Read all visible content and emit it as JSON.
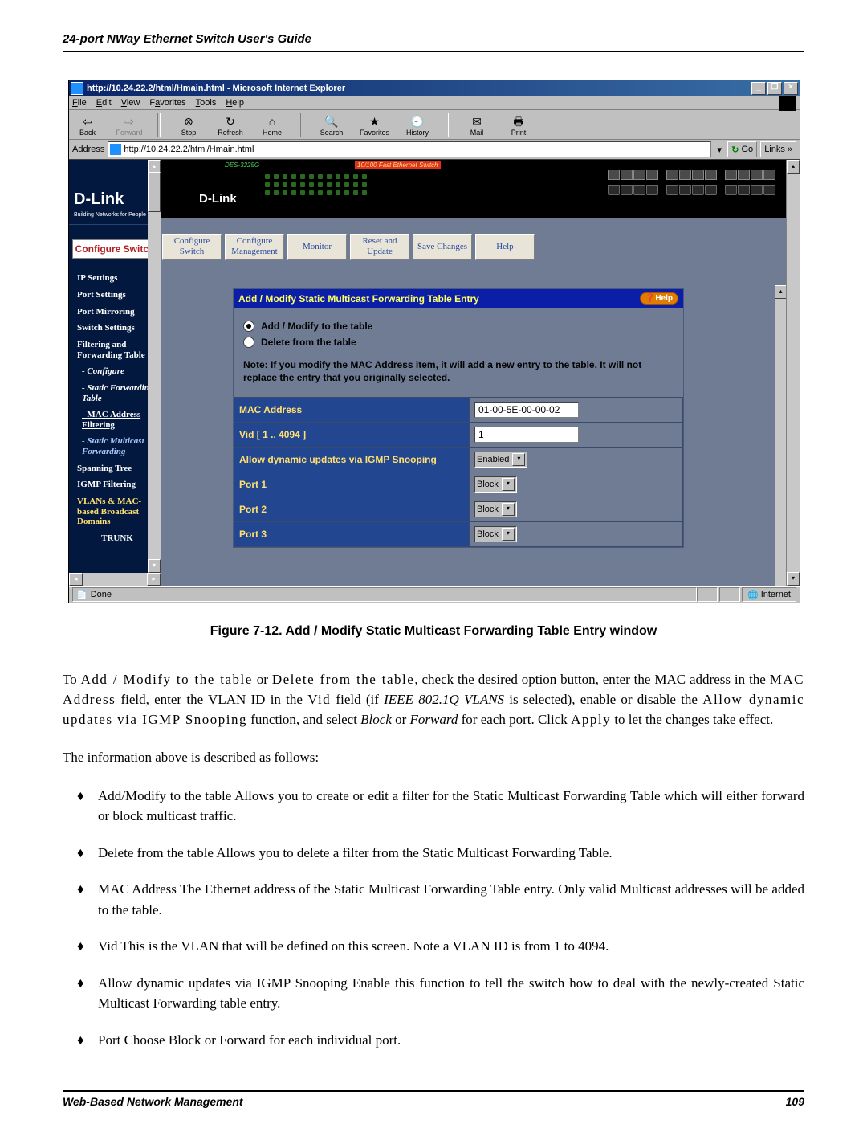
{
  "page": {
    "header": "24-port NWay Ethernet Switch User's Guide",
    "footer_left": "Web-Based Network Management",
    "footer_right": "109"
  },
  "caption": "Figure 7-12.  Add / Modify Static Multicast Forwarding Table Entry window",
  "browser": {
    "title": "http://10.24.22.2/html/Hmain.html - Microsoft Internet Explorer",
    "menu": {
      "file": "File",
      "edit": "Edit",
      "view": "View",
      "favorites": "Favorites",
      "tools": "Tools",
      "help": "Help"
    },
    "toolbar": {
      "back": "Back",
      "forward": "Forward",
      "stop": "Stop",
      "refresh": "Refresh",
      "home": "Home",
      "search": "Search",
      "favorites": "Favorites",
      "history": "History",
      "mail": "Mail",
      "print": "Print"
    },
    "address_label": "Address",
    "address_url": "http://10.24.22.2/html/Hmain.html",
    "go": "Go",
    "links": "Links",
    "status_done": "Done",
    "status_zone": "Internet"
  },
  "device": {
    "brand": "D-Link",
    "brand_sub": "Building Networks for People",
    "model": "DES-3225G",
    "banner": "10/100 Fast Ethernet Switch"
  },
  "sidebar": {
    "main_box": "Configure Switch",
    "items": [
      "IP Settings",
      "Port Settings",
      "Port Mirroring",
      "Switch Settings",
      "Filtering and Forwarding Table",
      "Configure",
      "Static Forwarding Table",
      "MAC Address Filtering",
      "Static Multicast Forwarding",
      "Spanning Tree",
      "IGMP Filtering",
      "VLANs & MAC-based Broadcast Domains",
      "TRUNK"
    ]
  },
  "tabs": {
    "t1": "Configure Switch",
    "t2": "Configure Management",
    "t3": "Monitor",
    "t4": "Reset and Update",
    "t5": "Save Changes",
    "t6": "Help"
  },
  "form": {
    "title": "Add / Modify Static Multicast Forwarding Table Entry",
    "help": "Help",
    "radio_add": "Add / Modify to the table",
    "radio_del": "Delete from the table",
    "note": "Note: If you modify the MAC Address item, it will add a new entry to the table. It will not replace the entry that you originally selected.",
    "rows": {
      "mac_lbl": "MAC Address",
      "mac_val": "01-00-5E-00-00-02",
      "vid_lbl": "Vid [ 1 .. 4094 ]",
      "vid_val": "1",
      "igmp_lbl": "Allow dynamic updates via IGMP Snooping",
      "igmp_val": "Enabled",
      "p1_lbl": "Port 1",
      "p1_val": "Block",
      "p2_lbl": "Port 2",
      "p2_val": "Block",
      "p3_lbl": "Port 3",
      "p3_val": "Block"
    }
  },
  "paragraphs": {
    "p1_a": "To ",
    "p1_add": "Add / Modify to the table",
    "p1_b": " or ",
    "p1_del": "Delete from the table",
    "p1_c": ", check the desired option button, enter the MAC address in the ",
    "p1_mac": "MAC Address",
    "p1_d": " field, enter the VLAN ID in the ",
    "p1_vid": "Vid",
    "p1_e": " field (if ",
    "p1_ieee": "IEEE 802.1Q VLANS",
    "p1_f": " is selected), enable or disable the ",
    "p1_igmp": "Allow dynamic updates via IGMP Snooping",
    "p1_g": " function, and select ",
    "p1_block": "Block",
    "p1_or": " or ",
    "p1_fwd": "Forward",
    "p1_h": " for each port. Click ",
    "p1_apply": "Apply",
    "p1_i": " to let the changes take effect.",
    "p2": "The information above is described as follows:"
  },
  "bullets": {
    "b1_head": "Add/Modify to the table",
    "b1_body": "  Allows you to create or edit a filter for the ",
    "b1_term": "Static Multicast Forwarding Table",
    "b1_tail": " which will either forward or block multicast traffic.",
    "b2_head": "Delete from the table",
    "b2_body": "  Allows you to delete a filter from the ",
    "b2_term": "Static Multicast Forwarding Table",
    "b2_tail": ".",
    "b3_head": "MAC Address",
    "b3_body": "  The Ethernet address of the ",
    "b3_term": "Static Multicast Forwarding Table",
    "b3_tail": " entry. Only valid Multicast addresses will be added to the table.",
    "b4_head": "Vid",
    "b4_body": "  This is the VLAN that will be defined on this screen. Note a VLAN ID is from 1 to 4094.",
    "b5_head": "Allow dynamic updates via IGMP Snooping",
    "b5_body": "  Enable this function to tell the switch how to deal with the newly-created Static Multicast Forwarding table entry.",
    "b6_head": "Port",
    "b6_body": "  Choose ",
    "b6_block": "Block",
    "b6_or": " or ",
    "b6_fwd": "Forward",
    "b6_tail": " for each individual port."
  }
}
